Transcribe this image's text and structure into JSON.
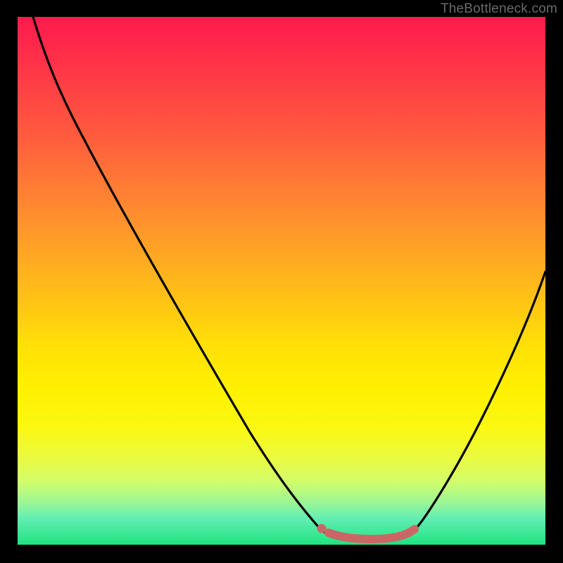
{
  "watermark": "TheBottleneck.com",
  "colors": {
    "background": "#000000",
    "curve_stroke": "#000000",
    "marker_fill": "#cc6666",
    "marker_stroke": "#cc6666"
  },
  "chart_data": {
    "type": "line",
    "title": "",
    "xlabel": "",
    "ylabel": "",
    "xlim": [
      0,
      100
    ],
    "ylim": [
      0,
      100
    ],
    "grid": false,
    "legend": false,
    "series": [
      {
        "name": "left-curve",
        "x": [
          3,
          10,
          20,
          30,
          40,
          50,
          56,
          58.5
        ],
        "y": [
          100,
          87,
          70,
          53,
          37,
          20,
          7,
          2.2
        ]
      },
      {
        "name": "valley-floor",
        "x": [
          58.5,
          62,
          66,
          70,
          73,
          75.5
        ],
        "y": [
          2.2,
          1.6,
          1.5,
          1.6,
          1.9,
          2.4
        ]
      },
      {
        "name": "right-curve",
        "x": [
          75.5,
          80,
          85,
          90,
          95,
          100
        ],
        "y": [
          2.4,
          9,
          19,
          31,
          43,
          55
        ]
      }
    ],
    "annotations": [
      {
        "name": "valley-start-marker",
        "x": 58.5,
        "y": 2.8,
        "r": 6
      },
      {
        "name": "valley-segment",
        "x0": 59.5,
        "y0": 2.2,
        "x1": 75.5,
        "y1": 2.4,
        "width": 10
      }
    ]
  }
}
